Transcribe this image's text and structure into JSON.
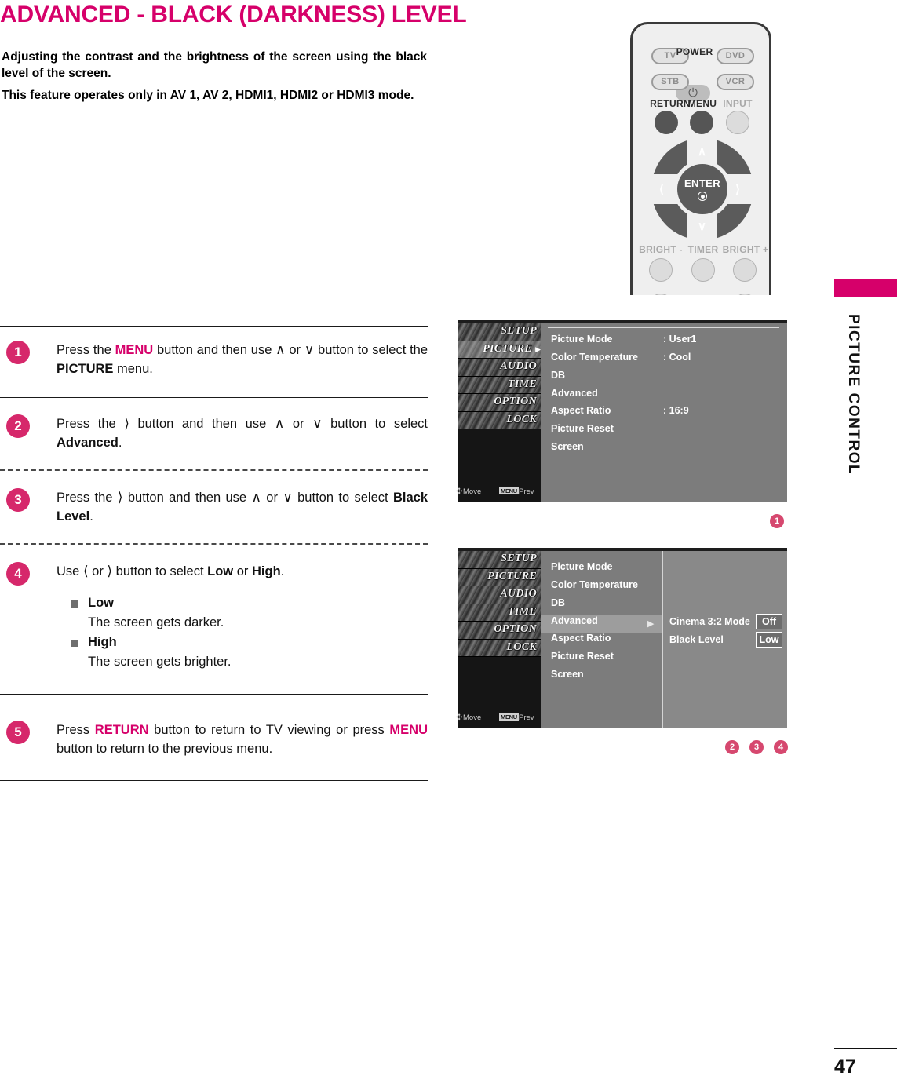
{
  "title": "ADVANCED - BLACK (DARKNESS) LEVEL",
  "intro": {
    "line1": "Adjusting the contrast and the brightness of the screen using the black level of the screen.",
    "line2": "This feature operates only in AV 1, AV 2, HDMI1, HDMI2 or HDMI3 mode."
  },
  "sidetab": {
    "label": "PICTURE CONTROL",
    "bar_color": "#d6006a"
  },
  "remote": {
    "buttons": {
      "tv": "TV",
      "power": "POWER",
      "dvd": "DVD",
      "stb": "STB",
      "vcr": "VCR",
      "return": "RETURN",
      "menu": "MENU",
      "input": "INPUT",
      "enter": "ENTER",
      "bright_minus": "BRIGHT -",
      "timer": "TIMER",
      "bright_plus": "BRIGHT +"
    }
  },
  "steps": [
    {
      "num": "1",
      "parts": [
        {
          "t": "Press the ",
          "s": "n"
        },
        {
          "t": "MENU",
          "s": "pink"
        },
        {
          "t": " button and then use ",
          "s": "n"
        },
        {
          "t": "∧",
          "s": "arrow"
        },
        {
          "t": " or ",
          "s": "n"
        },
        {
          "t": "∨",
          "s": "arrow"
        },
        {
          "t": " button to select the ",
          "s": "n"
        },
        {
          "t": "PICTURE",
          "s": "b"
        },
        {
          "t": " menu.",
          "s": "n"
        }
      ]
    },
    {
      "num": "2",
      "parts": [
        {
          "t": "Press the ",
          "s": "n"
        },
        {
          "t": "〉",
          "s": "arrow"
        },
        {
          "t": " button and then use ",
          "s": "n"
        },
        {
          "t": "∧",
          "s": "arrow"
        },
        {
          "t": " or ",
          "s": "n"
        },
        {
          "t": "∨",
          "s": "arrow"
        },
        {
          "t": " button to select ",
          "s": "n"
        },
        {
          "t": "Advanced",
          "s": "b"
        },
        {
          "t": ".",
          "s": "n"
        }
      ]
    },
    {
      "num": "3",
      "parts": [
        {
          "t": "Press the ",
          "s": "n"
        },
        {
          "t": "〉",
          "s": "arrow"
        },
        {
          "t": " button and then use ",
          "s": "n"
        },
        {
          "t": "∧",
          "s": "arrow"
        },
        {
          "t": " or ",
          "s": "n"
        },
        {
          "t": "∨",
          "s": "arrow"
        },
        {
          "t": " button to select ",
          "s": "n"
        },
        {
          "t": "Black Level",
          "s": "b"
        },
        {
          "t": ".",
          "s": "n"
        }
      ]
    },
    {
      "num": "4",
      "parts": [
        {
          "t": "Use ",
          "s": "n"
        },
        {
          "t": "〈",
          "s": "arrow"
        },
        {
          "t": " or ",
          "s": "n"
        },
        {
          "t": "〉",
          "s": "arrow"
        },
        {
          "t": " button to select ",
          "s": "n"
        },
        {
          "t": "Low",
          "s": "b"
        },
        {
          "t": " or ",
          "s": "n"
        },
        {
          "t": "High",
          "s": "b"
        },
        {
          "t": ".",
          "s": "n"
        }
      ],
      "bullets": [
        {
          "head": "Low",
          "sub": "The screen gets darker."
        },
        {
          "head": "High",
          "sub": "The screen gets brighter."
        }
      ]
    },
    {
      "num": "5",
      "parts": [
        {
          "t": "Press ",
          "s": "n"
        },
        {
          "t": "RETURN",
          "s": "pink"
        },
        {
          "t": " button to return to TV viewing or press ",
          "s": "n"
        },
        {
          "t": "MENU",
          "s": "pink"
        },
        {
          "t": " button to return to the previous menu.",
          "s": "n"
        }
      ]
    }
  ],
  "osd": {
    "categories": [
      "SETUP",
      "PICTURE",
      "AUDIO",
      "TIME",
      "OPTION",
      "LOCK"
    ],
    "footer": {
      "move": "Move",
      "menu_key": "MENU",
      "prev": "Prev"
    },
    "menu_items": [
      "Picture Mode",
      "Color Temperature",
      "DB",
      "Advanced",
      "Aspect Ratio",
      "Picture Reset",
      "Screen"
    ],
    "screen1": {
      "selected_category": "PICTURE",
      "values": {
        "Picture Mode": ": User1",
        "Color Temperature": ": Cool",
        "Aspect Ratio": ": 16:9"
      },
      "marker": "1"
    },
    "screen2": {
      "highlighted_item": "Advanced",
      "submenu": [
        {
          "label": "Cinema 3:2 Mode",
          "value": "Off"
        },
        {
          "label": "Black Level",
          "value": "Low"
        }
      ],
      "markers": [
        "2",
        "3",
        "4"
      ]
    }
  },
  "footer": {
    "page_number": "47"
  }
}
